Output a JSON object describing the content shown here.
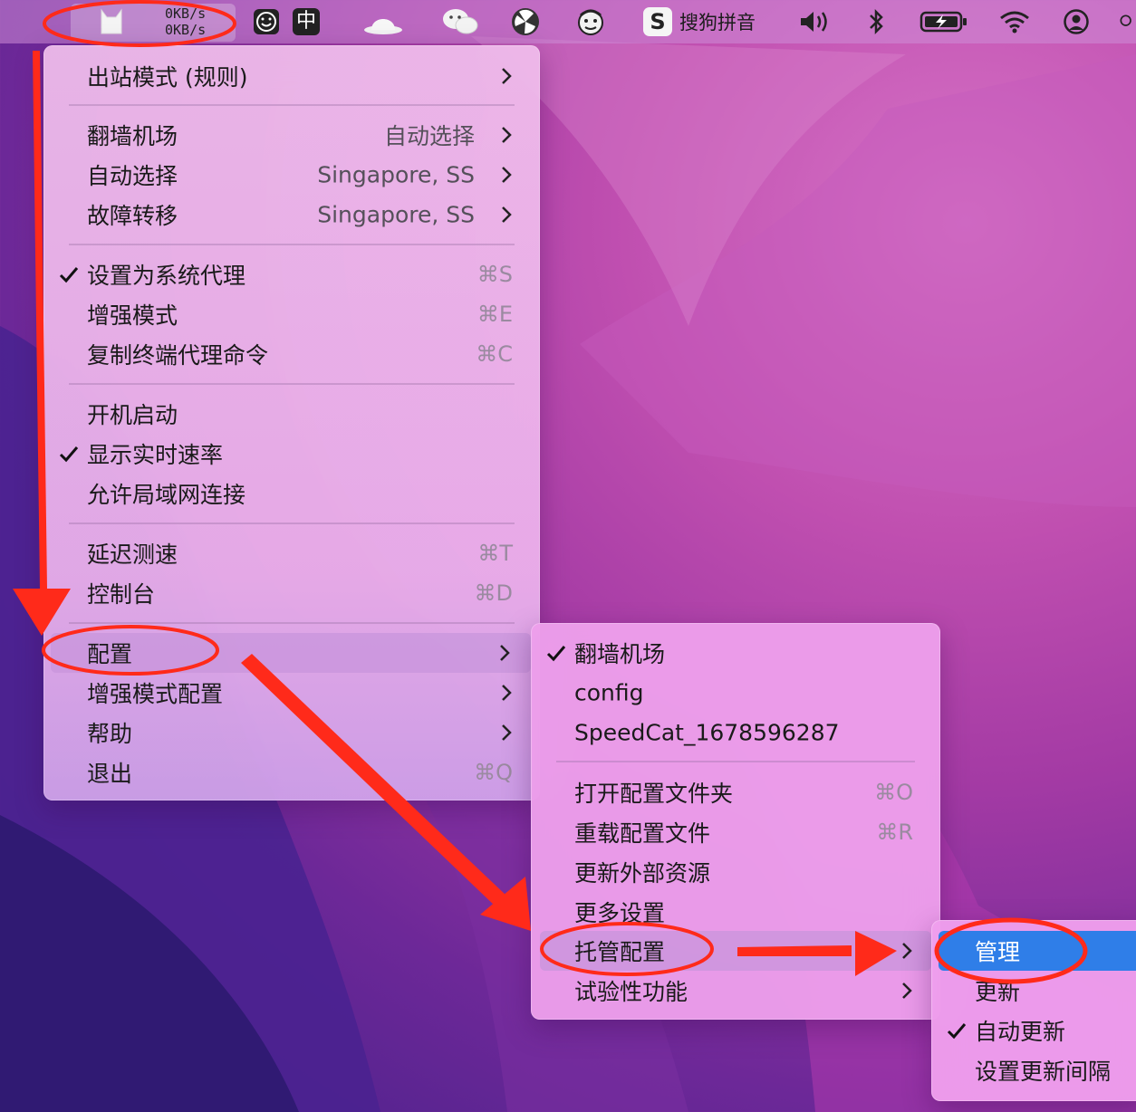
{
  "menubar": {
    "speed_up": "0KB/s",
    "speed_down": "0KB/s",
    "input_method_label": "中",
    "sogou_label": "搜狗拼音",
    "icons": [
      "cat-icon",
      "smiley-icon",
      "zhong-icon",
      "hat-icon",
      "wechat-icon",
      "fan-icon",
      "face-icon",
      "sogou-icon",
      "volume-icon",
      "bluetooth-icon",
      "battery-icon",
      "wifi-icon",
      "user-icon",
      "search-icon"
    ]
  },
  "main_menu": {
    "items": [
      {
        "label": "出站模式 (规则)"
      },
      {
        "label": "翻墙机场",
        "value": "自动选择"
      },
      {
        "label": "自动选择",
        "value": "Singapore, SS"
      },
      {
        "label": "故障转移",
        "value": "Singapore, SS"
      },
      {
        "label": "设置为系统代理",
        "shortcut": "⌘S"
      },
      {
        "label": "增强模式",
        "shortcut": "⌘E"
      },
      {
        "label": "复制终端代理命令",
        "shortcut": "⌘C"
      },
      {
        "label": "开机启动"
      },
      {
        "label": "显示实时速率"
      },
      {
        "label": "允许局域网连接"
      },
      {
        "label": "延迟测速",
        "shortcut": "⌘T"
      },
      {
        "label": "控制台",
        "shortcut": "⌘D"
      },
      {
        "label": "配置"
      },
      {
        "label": "增强模式配置"
      },
      {
        "label": "帮助"
      },
      {
        "label": "退出",
        "shortcut": "⌘Q"
      }
    ]
  },
  "config_submenu": {
    "items": [
      {
        "label": "翻墙机场"
      },
      {
        "label": "config"
      },
      {
        "label": "SpeedCat_1678596287"
      },
      {
        "label": "打开配置文件夹",
        "shortcut": "⌘O"
      },
      {
        "label": "重载配置文件",
        "shortcut": "⌘R"
      },
      {
        "label": "更新外部资源"
      },
      {
        "label": "更多设置"
      },
      {
        "label": "托管配置"
      },
      {
        "label": "试验性功能"
      }
    ]
  },
  "managed_submenu": {
    "items": [
      {
        "label": "管理"
      },
      {
        "label": "更新"
      },
      {
        "label": "自动更新"
      },
      {
        "label": "设置更新间隔"
      }
    ]
  },
  "colors": {
    "highlight_blue": "#2f7ee8",
    "annotation_red": "#ff2a1a"
  }
}
